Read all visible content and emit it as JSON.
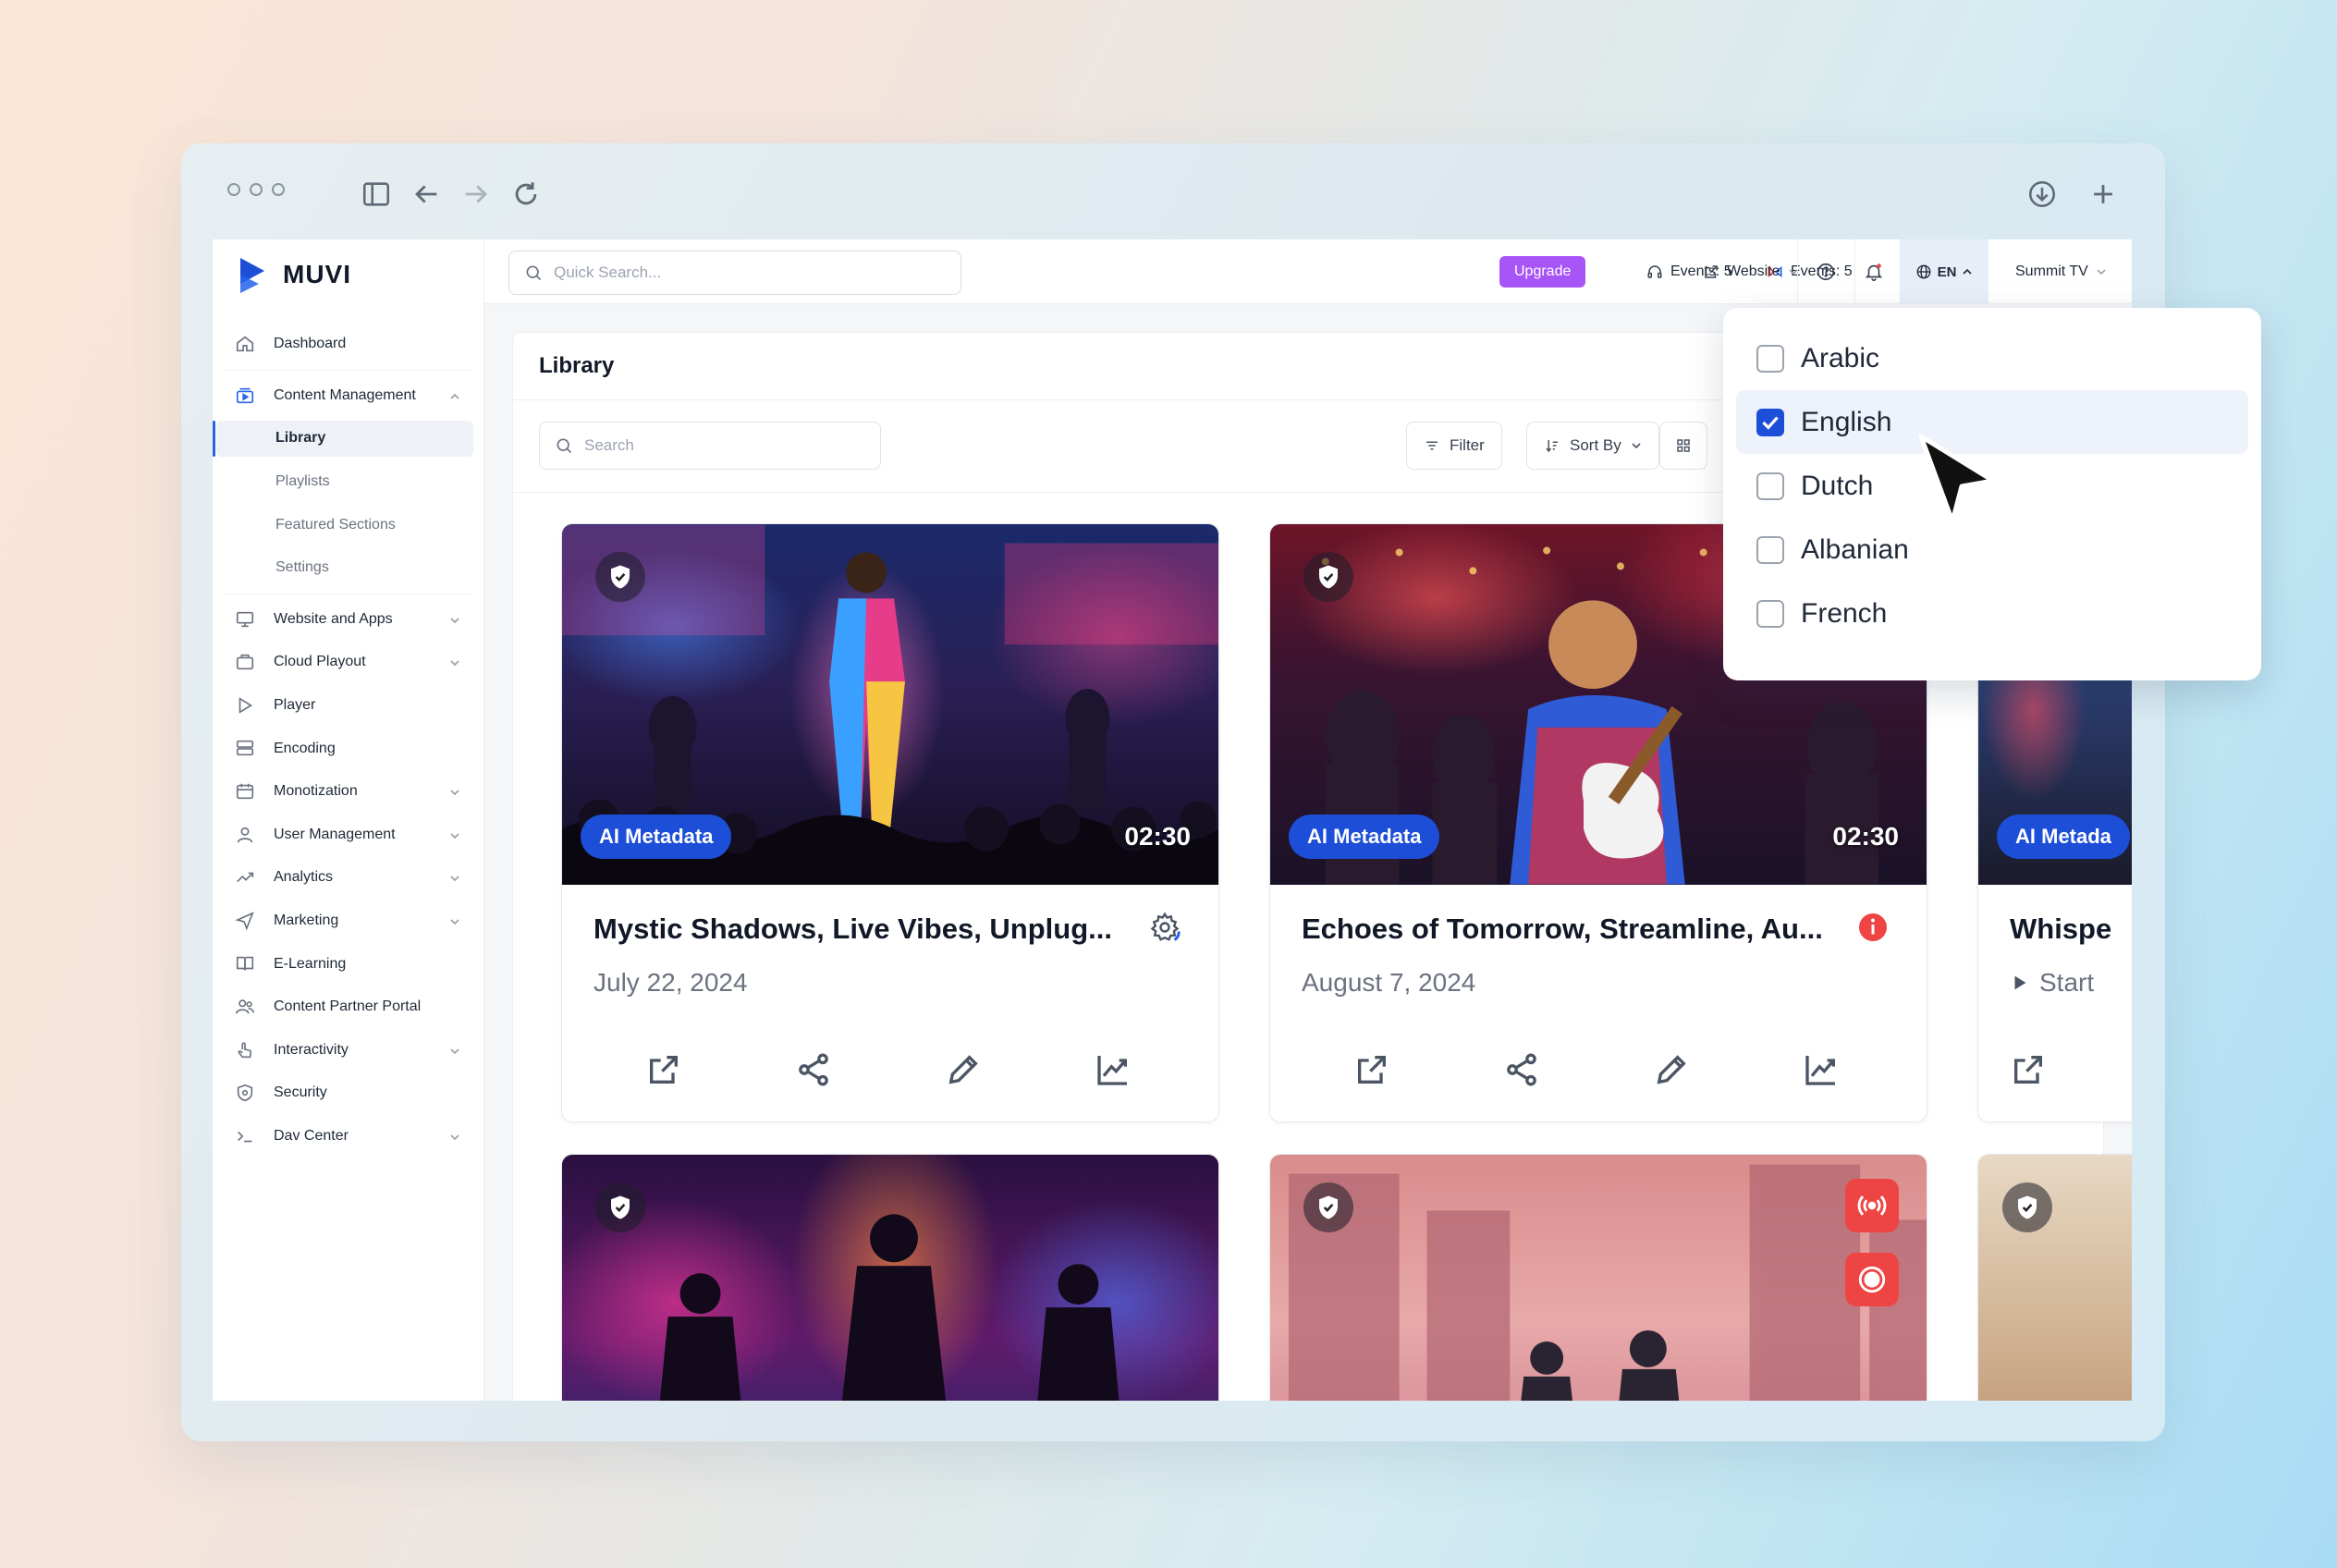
{
  "brand": {
    "name": "MUVI"
  },
  "sidebar": {
    "items": [
      {
        "label": "Dashboard",
        "icon": "home-icon",
        "chevron": false
      },
      {
        "label": "Content Management",
        "icon": "content-icon",
        "chevron": true,
        "expanded": true
      },
      {
        "label": "Website and Apps",
        "icon": "monitor-icon",
        "chevron": true
      },
      {
        "label": "Cloud Playout",
        "icon": "playout-icon",
        "chevron": true
      },
      {
        "label": "Player",
        "icon": "play-icon",
        "chevron": false
      },
      {
        "label": "Encoding",
        "icon": "encoding-icon",
        "chevron": false
      },
      {
        "label": "Monotization",
        "icon": "monetization-icon",
        "chevron": true
      },
      {
        "label": "User Management",
        "icon": "user-icon",
        "chevron": true
      },
      {
        "label": "Analytics",
        "icon": "analytics-icon",
        "chevron": true
      },
      {
        "label": "Marketing",
        "icon": "marketing-icon",
        "chevron": true
      },
      {
        "label": "E-Learning",
        "icon": "book-icon",
        "chevron": false
      },
      {
        "label": "Content Partner Portal",
        "icon": "partner-icon",
        "chevron": false
      },
      {
        "label": "Interactivity",
        "icon": "interactivity-icon",
        "chevron": true
      },
      {
        "label": "Security",
        "icon": "shield-icon",
        "chevron": false
      },
      {
        "label": "Dav Center",
        "icon": "terminal-icon",
        "chevron": true
      }
    ],
    "sub_items": [
      "Library",
      "Playlists",
      "Featured Sections",
      "Settings"
    ],
    "active_sub": "Library"
  },
  "topbar": {
    "search_placeholder": "Quick Search...",
    "upgrade": "Upgrade",
    "events_1": "Events: 5",
    "events_2": "Events: 5",
    "website": "Website",
    "language": "EN",
    "account": "Summit TV"
  },
  "library": {
    "title": "Library",
    "search_placeholder": "Search",
    "filter": "Filter",
    "sort_by": "Sort By"
  },
  "cards": [
    {
      "badge": "AI Metadata",
      "duration": "02:30",
      "title": "Mystic Shadows, Live Vibes, Unplug...",
      "date": "July 22, 2024",
      "status_icon": "gear-icon"
    },
    {
      "badge": "AI Metadata",
      "duration": "02:30",
      "title": "Echoes of Tomorrow, Streamline, Au...",
      "date": "August 7, 2024",
      "status_icon": "info-icon"
    },
    {
      "badge": "AI Metada",
      "title": "Whispe",
      "date": "Start"
    }
  ],
  "language_dropdown": {
    "options": [
      {
        "label": "Arabic",
        "checked": false
      },
      {
        "label": "English",
        "checked": true
      },
      {
        "label": "Dutch",
        "checked": false
      },
      {
        "label": "Albanian",
        "checked": false
      },
      {
        "label": "French",
        "checked": false
      }
    ]
  },
  "colors": {
    "accent": "#1d4ed8",
    "upgrade": "#a855f7",
    "alert": "#ef4444"
  }
}
